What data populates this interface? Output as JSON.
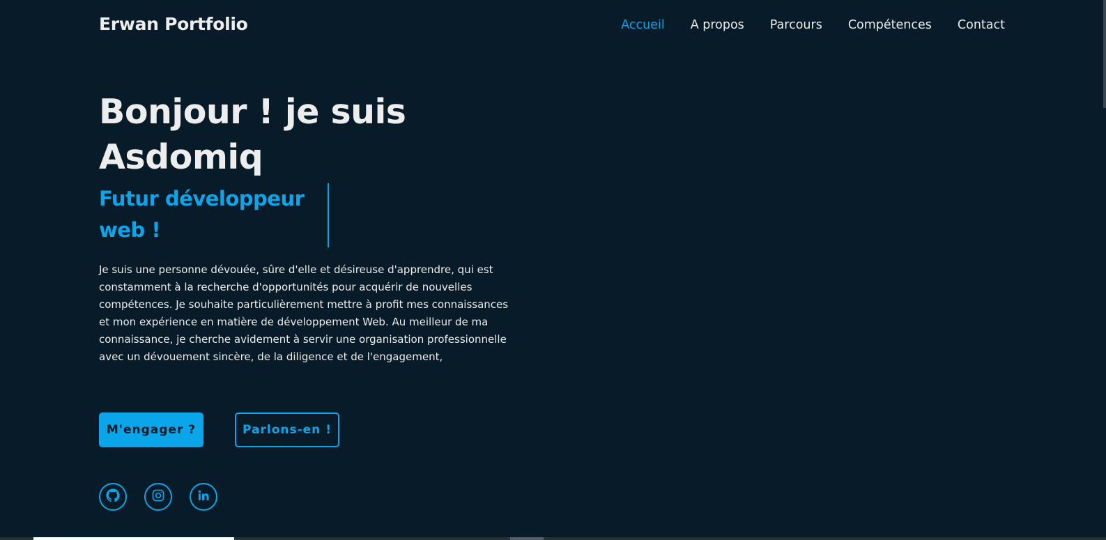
{
  "header": {
    "logo": "Erwan Portfolio",
    "nav": [
      {
        "label": "Accueil",
        "active": true
      },
      {
        "label": "A propos",
        "active": false
      },
      {
        "label": "Parcours",
        "active": false
      },
      {
        "label": "Compétences",
        "active": false
      },
      {
        "label": "Contact",
        "active": false
      }
    ]
  },
  "hero": {
    "title_line1": "Bonjour ! je suis",
    "title_line2": "Asdomiq",
    "subtitle_line1": "Futur développeur",
    "subtitle_line2": "web !",
    "bio": "Je suis une personne dévouée, sûre d'elle et désireuse d'apprendre, qui est constamment à la recherche d'opportunités pour acquérir de nouvelles compétences. Je souhaite particulièrement mettre à profit mes connaissances et mon expérience en matière de développement Web. Au meilleur de ma connaissance, je cherche avidement à servir une organisation professionnelle avec un dévouement sincère, de la diligence et de l'engagement,"
  },
  "buttons": {
    "primary": "M'engager ?",
    "secondary": "Parlons-en !"
  },
  "social": [
    {
      "icon": "github-icon"
    },
    {
      "icon": "instagram-icon"
    },
    {
      "icon": "linkedin-icon"
    }
  ],
  "colors": {
    "background": "#081b29",
    "accent": "#0ba5e9",
    "text": "#ededed"
  }
}
